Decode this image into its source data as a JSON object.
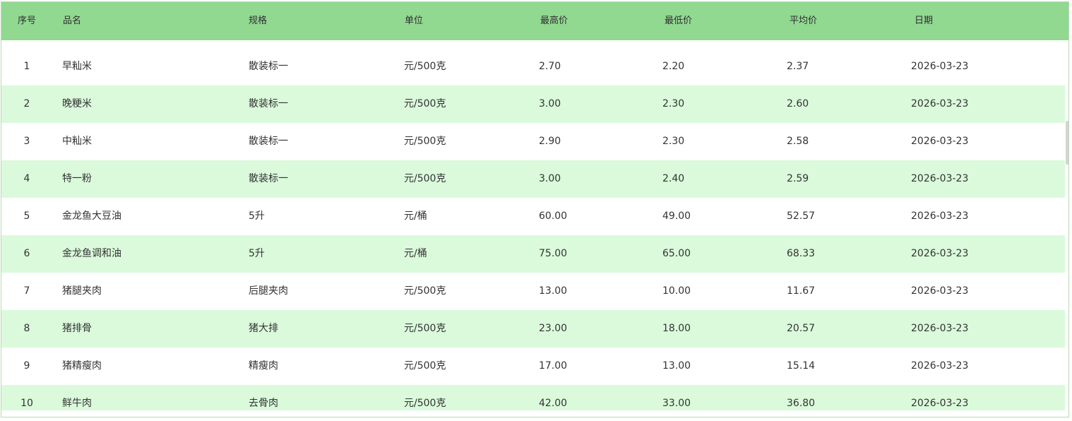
{
  "table": {
    "headers": [
      "序号",
      "品名",
      "规格",
      "单位",
      "最高价",
      "最低价",
      "平均价",
      "日期"
    ],
    "rows": [
      [
        "1",
        "早籼米",
        "散装标一",
        "元/500克",
        "2.70",
        "2.20",
        "2.37",
        "2026-03-23"
      ],
      [
        "2",
        "晚粳米",
        "散装标一",
        "元/500克",
        "3.00",
        "2.30",
        "2.60",
        "2026-03-23"
      ],
      [
        "3",
        "中籼米",
        "散装标一",
        "元/500克",
        "2.90",
        "2.30",
        "2.58",
        "2026-03-23"
      ],
      [
        "4",
        "特一粉",
        "散装标一",
        "元/500克",
        "3.00",
        "2.40",
        "2.59",
        "2026-03-23"
      ],
      [
        "5",
        "金龙鱼大豆油",
        "5升",
        "元/桶",
        "60.00",
        "49.00",
        "52.57",
        "2026-03-23"
      ],
      [
        "6",
        "金龙鱼调和油",
        "5升",
        "元/桶",
        "75.00",
        "65.00",
        "68.33",
        "2026-03-23"
      ],
      [
        "7",
        "猪腿夹肉",
        "后腿夹肉",
        "元/500克",
        "13.00",
        "10.00",
        "11.67",
        "2026-03-23"
      ],
      [
        "8",
        "猪排骨",
        "猪大排",
        "元/500克",
        "23.00",
        "18.00",
        "20.57",
        "2026-03-23"
      ],
      [
        "9",
        "猪精瘦肉",
        "精瘦肉",
        "元/500克",
        "17.00",
        "13.00",
        "15.14",
        "2026-03-23"
      ],
      [
        "10",
        "鲜牛肉",
        "去骨肉",
        "元/500克",
        "42.00",
        "33.00",
        "36.80",
        "2026-03-23"
      ]
    ]
  },
  "colors": {
    "header_bg": "#91d891",
    "alt_row_bg": "#dafadb",
    "row_bg": "#ffffff",
    "text": "#333333"
  }
}
